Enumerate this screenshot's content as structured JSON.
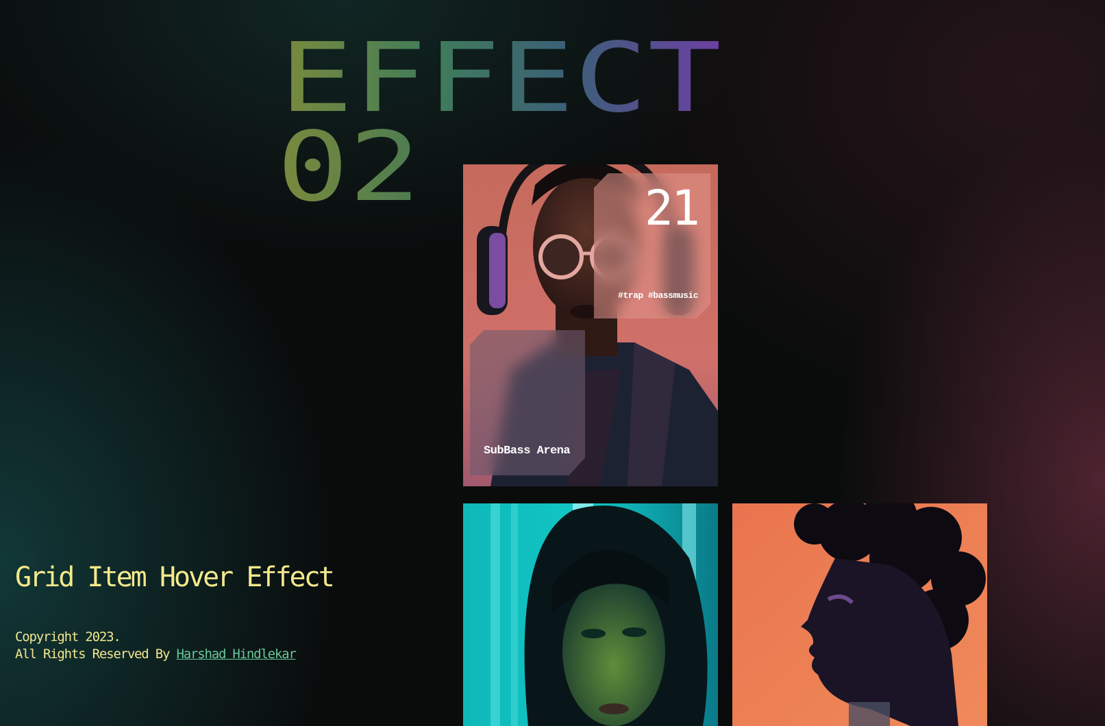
{
  "title": {
    "line1": "EFFECT",
    "line2": "02"
  },
  "card_main": {
    "number": "21",
    "tags": "#trap #bassmusic",
    "name": "SubBass Arena"
  },
  "footer": {
    "caption": "Grid Item Hover Effect",
    "copyright": "Copyright 2023.",
    "rights": "All Rights Reserved By",
    "author": "Harshad Hindlekar"
  },
  "colors": {
    "title_gradient": [
      "#7a8d3d",
      "#2f7f62",
      "#3d5f7e",
      "#6a3fa0"
    ],
    "caption": "#f3e98c",
    "link": "#68c99a"
  }
}
